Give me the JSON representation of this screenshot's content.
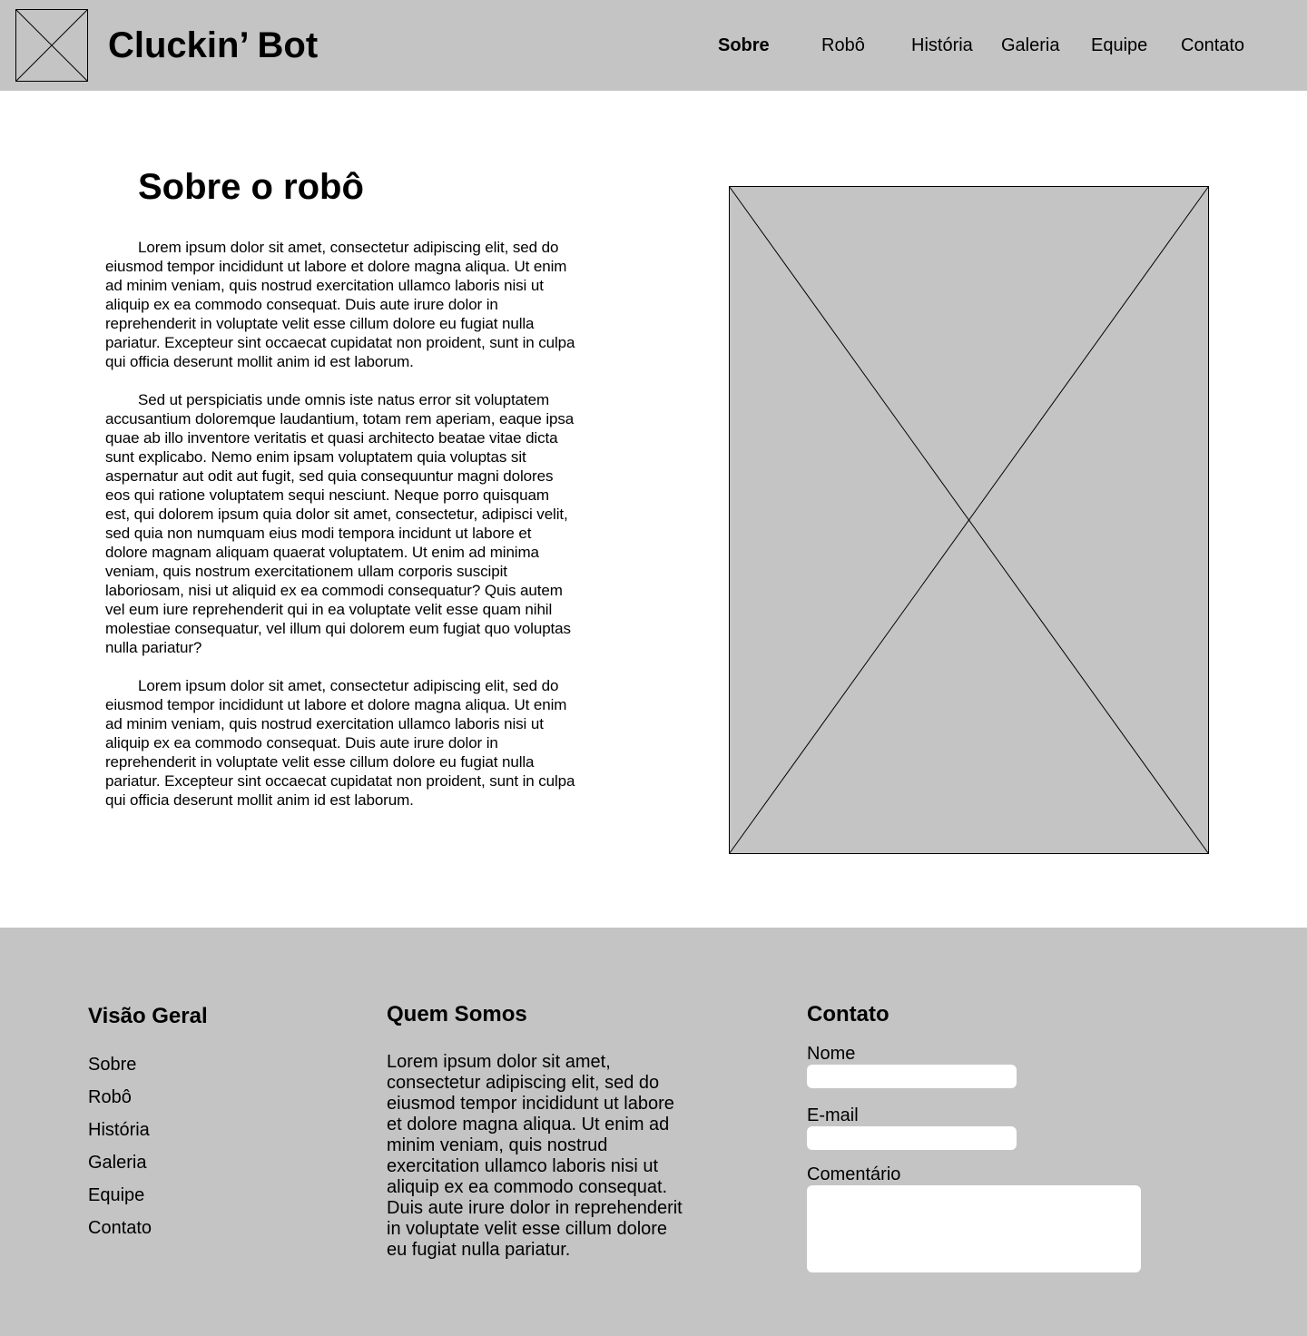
{
  "header": {
    "title": "Cluckin’ Bot",
    "logo_icon": "image-placeholder-icon",
    "background": "#c4c4c4",
    "nav": [
      {
        "label": "Sobre",
        "active": true
      },
      {
        "label": "Robô",
        "active": false
      },
      {
        "label": "História",
        "active": false
      },
      {
        "label": "Galeria",
        "active": false
      },
      {
        "label": "Equipe",
        "active": false
      },
      {
        "label": "Contato",
        "active": false
      }
    ]
  },
  "main": {
    "heading": "Sobre o robô",
    "paragraphs": [
      "Lorem ipsum dolor sit amet, consectetur adipiscing elit, sed do eiusmod tempor incididunt ut labore et dolore magna aliqua. Ut enim ad minim veniam, quis nostrud exercitation ullamco laboris nisi ut aliquip ex ea commodo consequat. Duis aute irure dolor in reprehenderit in voluptate velit esse cillum dolore eu fugiat nulla pariatur. Excepteur sint occaecat cupidatat non proident, sunt in culpa qui officia deserunt mollit anim id est laborum.",
      "Sed ut perspiciatis unde omnis iste natus error sit voluptatem accusantium doloremque laudantium, totam rem aperiam, eaque ipsa quae ab illo inventore veritatis et quasi architecto beatae vitae dicta sunt explicabo. Nemo enim ipsam voluptatem quia voluptas sit aspernatur aut odit aut fugit, sed quia consequuntur magni dolores eos qui ratione voluptatem sequi nesciunt. Neque porro quisquam est, qui dolorem ipsum quia dolor sit amet, consectetur, adipisci velit, sed quia non numquam eius modi tempora incidunt ut labore et dolore magnam aliquam quaerat voluptatem. Ut enim ad minima veniam, quis nostrum exercitationem ullam corporis suscipit laboriosam, nisi ut aliquid ex ea commodi consequatur? Quis autem vel eum iure reprehenderit qui in ea voluptate velit esse quam nihil molestiae consequatur, vel illum qui dolorem eum fugiat quo voluptas nulla pariatur?",
      "Lorem ipsum dolor sit amet, consectetur adipiscing elit, sed do eiusmod tempor incididunt ut labore et dolore magna aliqua. Ut enim ad minim veniam, quis nostrud exercitation ullamco laboris nisi ut aliquip ex ea commodo consequat. Duis aute irure dolor in reprehenderit in voluptate velit esse cillum dolore eu fugiat nulla pariatur. Excepteur sint occaecat cupidatat non proident, sunt in culpa qui officia deserunt mollit anim id est laborum."
    ],
    "image_icon": "image-placeholder-icon"
  },
  "footer": {
    "overview": {
      "heading": "Visão Geral",
      "links": [
        "Sobre",
        "Robô",
        "História",
        "Galeria",
        "Equipe",
        "Contato"
      ]
    },
    "about_us": {
      "heading": "Quem Somos",
      "text": "Lorem ipsum dolor sit amet, consectetur adipiscing elit, sed do eiusmod tempor incididunt ut labore et dolore magna aliqua. Ut enim ad minim veniam, quis nostrud exercitation ullamco laboris nisi ut aliquip ex ea commodo consequat. Duis aute irure dolor in reprehenderit in voluptate velit esse cillum dolore eu fugiat nulla pariatur."
    },
    "contact": {
      "heading": "Contato",
      "name_label": "Nome",
      "name_value": "",
      "email_label": "E-mail",
      "email_value": "",
      "comment_label": "Comentário",
      "comment_value": ""
    }
  }
}
